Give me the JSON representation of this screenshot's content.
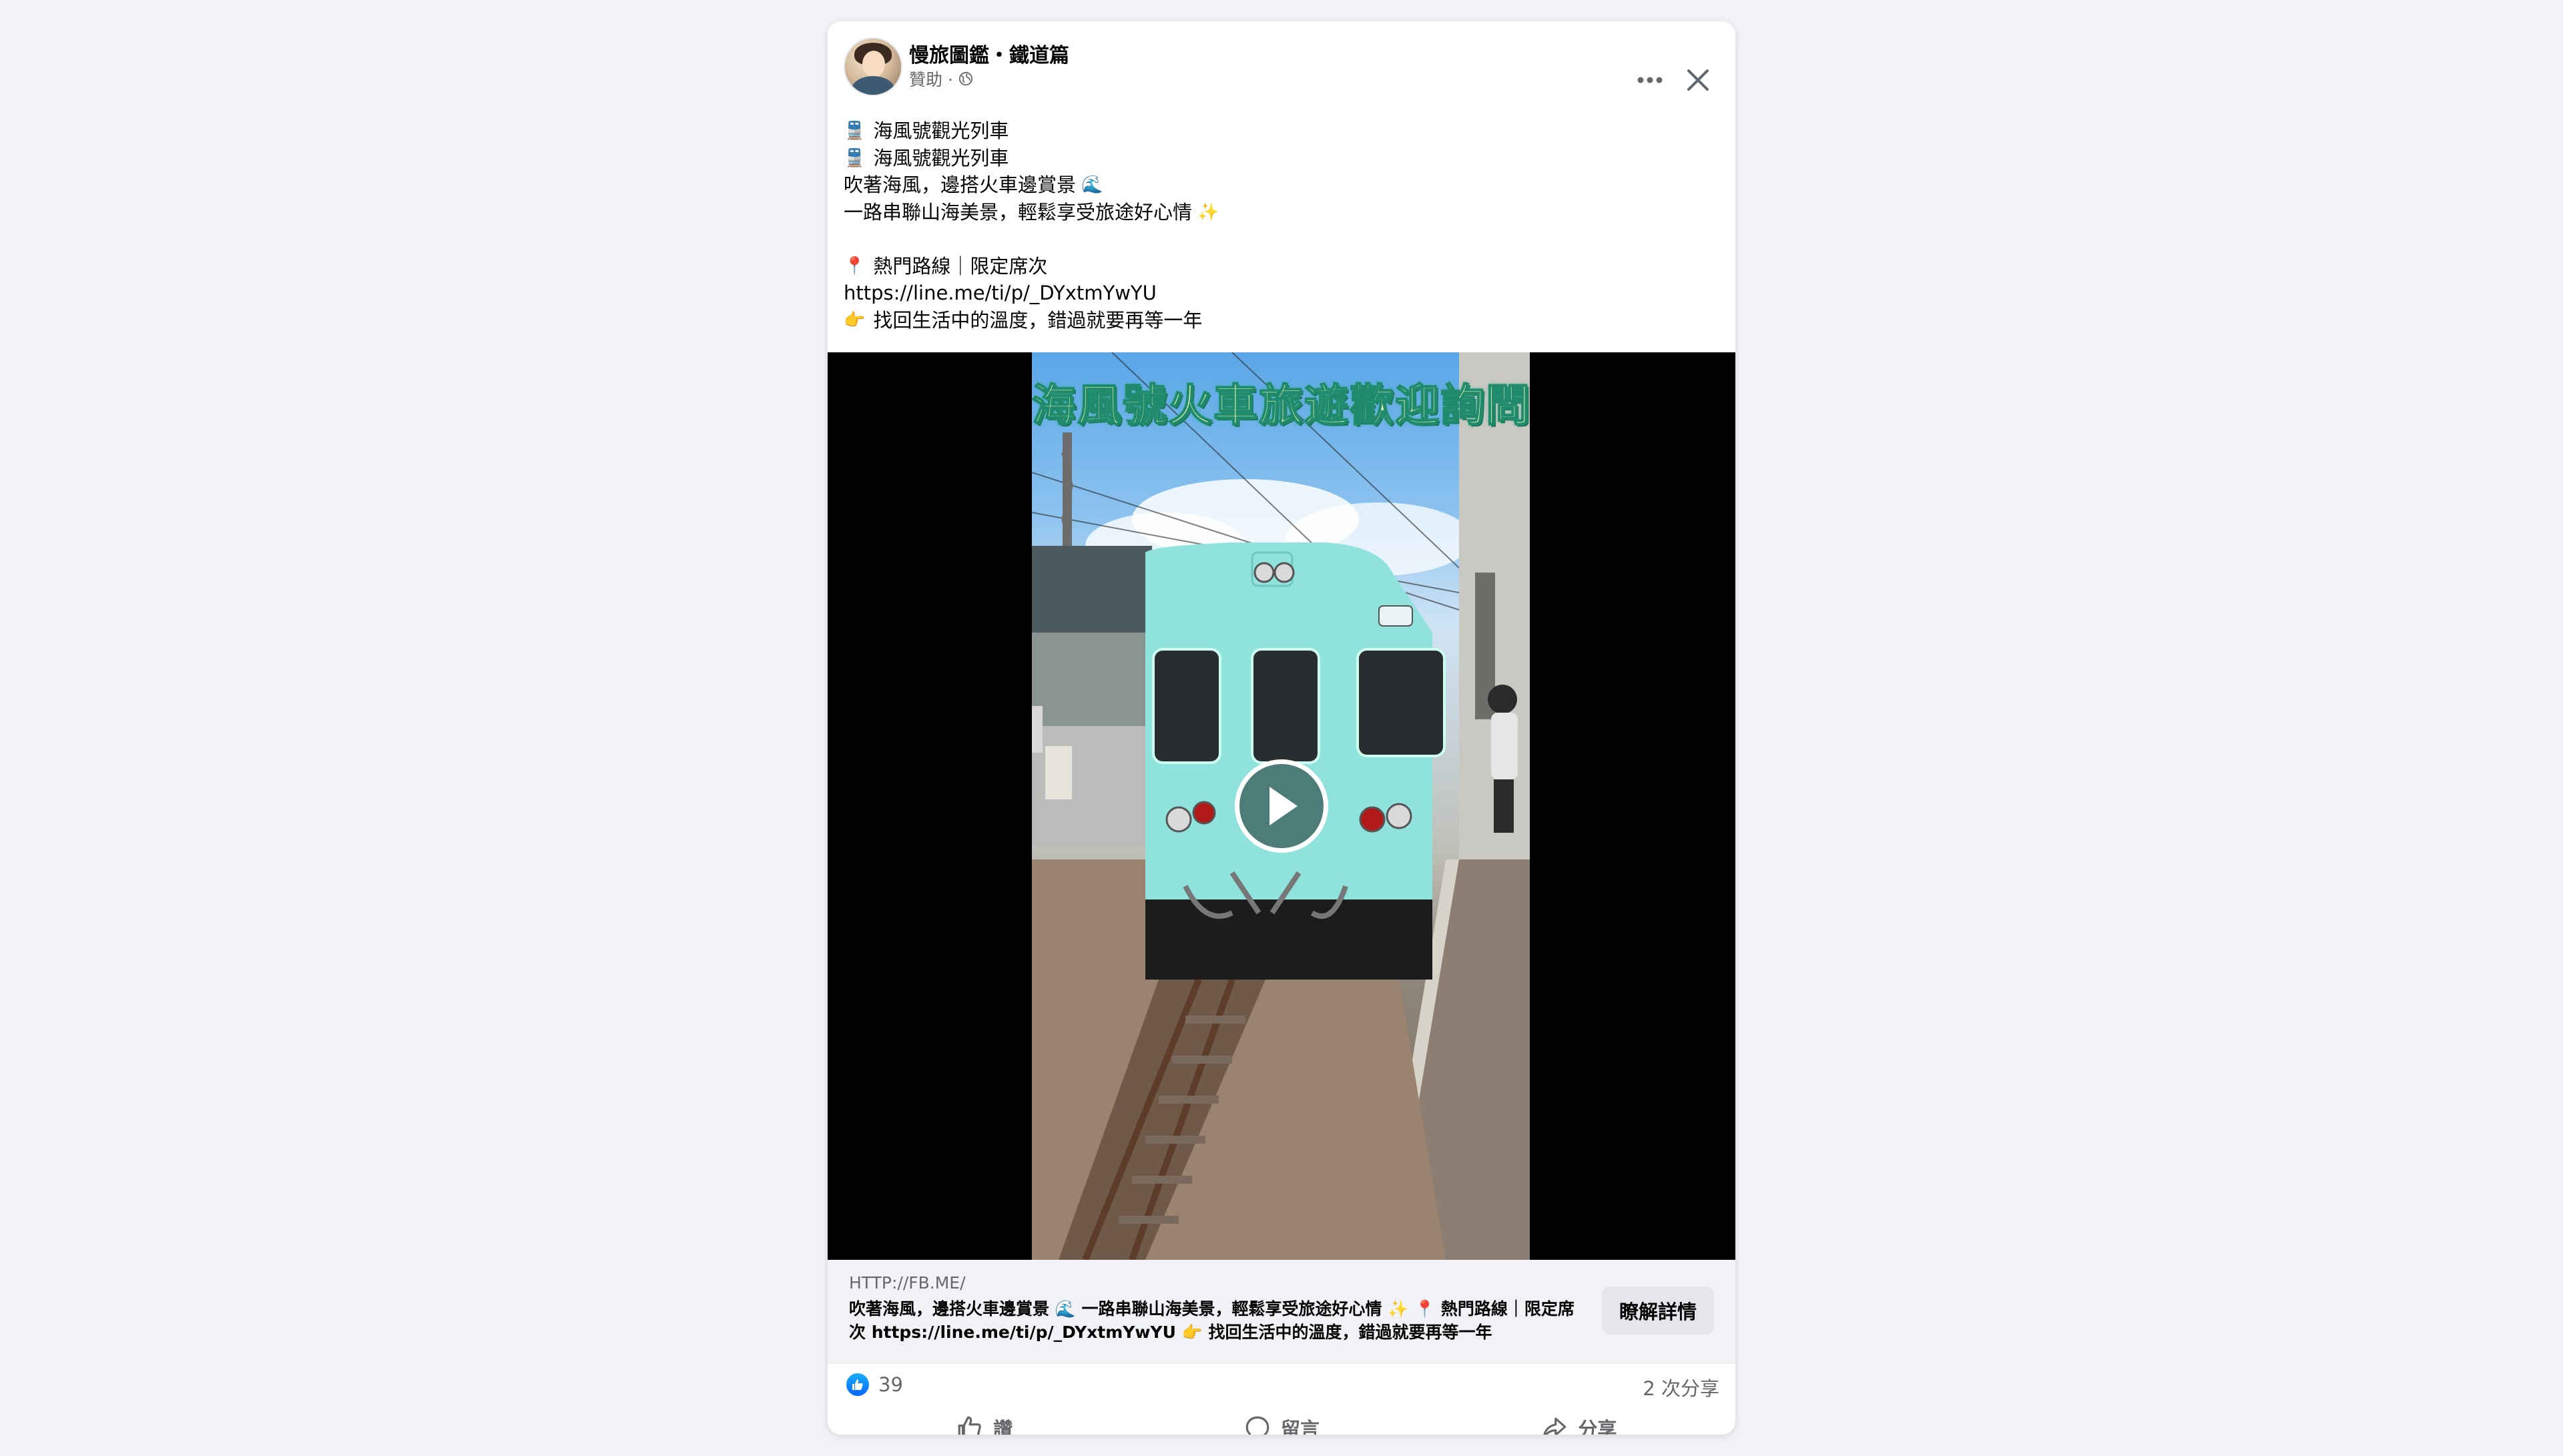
{
  "post": {
    "page_name": "慢旅圖鑑・鐵道篇",
    "sponsored_label": "贊助 ·",
    "text_lines": [
      {
        "glyph": "🚆",
        "text": "海風號觀光列車",
        "tail": ""
      },
      {
        "glyph": "🚆",
        "text": "海風號觀光列車",
        "tail": ""
      },
      {
        "glyph": "",
        "text": "吹著海風，邊搭火車邊賞景",
        "tail": "🌊"
      },
      {
        "glyph": "",
        "text": "一路串聯山海美景，輕鬆享受旅途好心情",
        "tail": "✨"
      },
      {
        "glyph": "",
        "text": "",
        "tail": ""
      },
      {
        "glyph": "📍",
        "text": "熱門路線｜限定席次",
        "tail": ""
      },
      {
        "glyph": "",
        "text": "https://line.me/ti/p/_DYxtmYwYU",
        "tail": ""
      },
      {
        "glyph": "👉",
        "text": "找回生活中的溫度，錯過就要再等一年",
        "tail": ""
      }
    ]
  },
  "video": {
    "overlay_title": "海風號火車旅遊歡迎詢問"
  },
  "link": {
    "domain": "HTTP://FB.ME/",
    "description": "吹著海風，邊搭火車邊賞景 🌊 一路串聯山海美景，輕鬆享受旅途好心情 ✨ 📍 熱門路線｜限定席次 https://line.me/ti/p/_DYxtmYwYU 👉 找回生活中的溫度，錯過就要再等一年",
    "cta_label": "瞭解詳情"
  },
  "stats": {
    "reaction_count": "39",
    "share_count": "2 次分享"
  },
  "actions": {
    "like_label": "讚",
    "comment_label": "留言",
    "share_label": "分享"
  },
  "icons": {
    "more": "more-horizontal-icon",
    "close": "close-icon",
    "globe": "globe-icon",
    "play": "play-icon",
    "like": "thumbs-up-icon",
    "comment": "comment-icon",
    "share": "share-arrow-icon"
  },
  "colors": {
    "background": "#f0f2f5",
    "card": "#ffffff",
    "secondary_text": "#65676b",
    "like_blue": "#0866ff",
    "video_title": "#f6ffb8",
    "train_body": "#8fe3dc"
  }
}
